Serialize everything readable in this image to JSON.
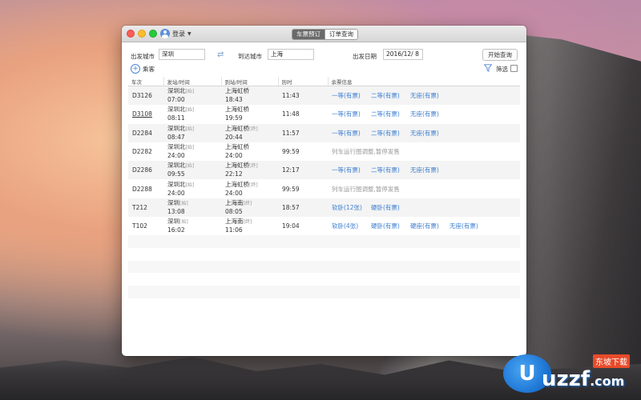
{
  "titlebar": {
    "login_label": "登录",
    "tabs": [
      {
        "label": "车票预订",
        "active": true
      },
      {
        "label": "订单查询",
        "active": false
      }
    ]
  },
  "form": {
    "from_label": "出发城市",
    "from_value": "深圳",
    "to_label": "到达城市",
    "to_value": "上海",
    "date_label": "出发日期",
    "date_value": "2016/12/  8",
    "search_button": "开始查询",
    "passenger_label": "乘客",
    "filter_label": "筛选"
  },
  "table": {
    "headers": [
      "车次",
      "发站/时间",
      "到站/时间",
      "历时",
      "余票信息"
    ],
    "rows": [
      {
        "train": "D3126",
        "from": "深圳北",
        "from_tag": "[始]",
        "dep": "07:00",
        "to": "上海虹桥",
        "to_tag": "",
        "arr": "18:43",
        "duration": "11:43",
        "seats": [
          "一等(有票)",
          "二等(有票)",
          "无座(有票)"
        ],
        "notice": ""
      },
      {
        "train": "D3108",
        "from": "深圳北",
        "from_tag": "[始]",
        "dep": "08:11",
        "to": "上海虹桥",
        "to_tag": "",
        "arr": "19:59",
        "duration": "11:48",
        "seats": [
          "一等(有票)",
          "二等(有票)",
          "无座(有票)"
        ],
        "notice": ""
      },
      {
        "train": "D2284",
        "from": "深圳北",
        "from_tag": "[始]",
        "dep": "08:47",
        "to": "上海虹桥",
        "to_tag": "[终]",
        "arr": "20:44",
        "duration": "11:57",
        "seats": [
          "一等(有票)",
          "二等(有票)",
          "无座(有票)"
        ],
        "notice": ""
      },
      {
        "train": "D2282",
        "from": "深圳北",
        "from_tag": "[始]",
        "dep": "24:00",
        "to": "上海虹桥",
        "to_tag": "",
        "arr": "24:00",
        "duration": "99:59",
        "seats": [],
        "notice": "列车运行图调整,暂停发售"
      },
      {
        "train": "D2286",
        "from": "深圳北",
        "from_tag": "[始]",
        "dep": "09:55",
        "to": "上海虹桥",
        "to_tag": "[终]",
        "arr": "22:12",
        "duration": "12:17",
        "seats": [
          "一等(有票)",
          "二等(有票)",
          "无座(有票)"
        ],
        "notice": ""
      },
      {
        "train": "D2288",
        "from": "深圳北",
        "from_tag": "[始]",
        "dep": "24:00",
        "to": "上海虹桥",
        "to_tag": "[终]",
        "arr": "24:00",
        "duration": "99:59",
        "seats": [],
        "notice": "列车运行图调整,暂停发售"
      },
      {
        "train": "T212",
        "from": "深圳",
        "from_tag": "[始]",
        "dep": "13:08",
        "to": "上海南",
        "to_tag": "[终]",
        "arr": "08:05",
        "duration": "18:57",
        "seats": [
          "软卧(12张)",
          "硬卧(有票)"
        ],
        "notice": ""
      },
      {
        "train": "T102",
        "from": "深圳",
        "from_tag": "[始]",
        "dep": "16:02",
        "to": "上海南",
        "to_tag": "[终]",
        "arr": "11:06",
        "duration": "19:04",
        "seats": [
          "软卧(4张)",
          "硬卧(有票)",
          "硬座(有票)",
          "无座(有票)"
        ],
        "notice": ""
      }
    ]
  },
  "watermark": {
    "logo_letter": "U",
    "brand": "uzzf",
    "suffix": ".com",
    "tagline": "东坡下载"
  },
  "colors": {
    "accent": "#3e7fd1",
    "active_tab": "#6a6a6a"
  }
}
